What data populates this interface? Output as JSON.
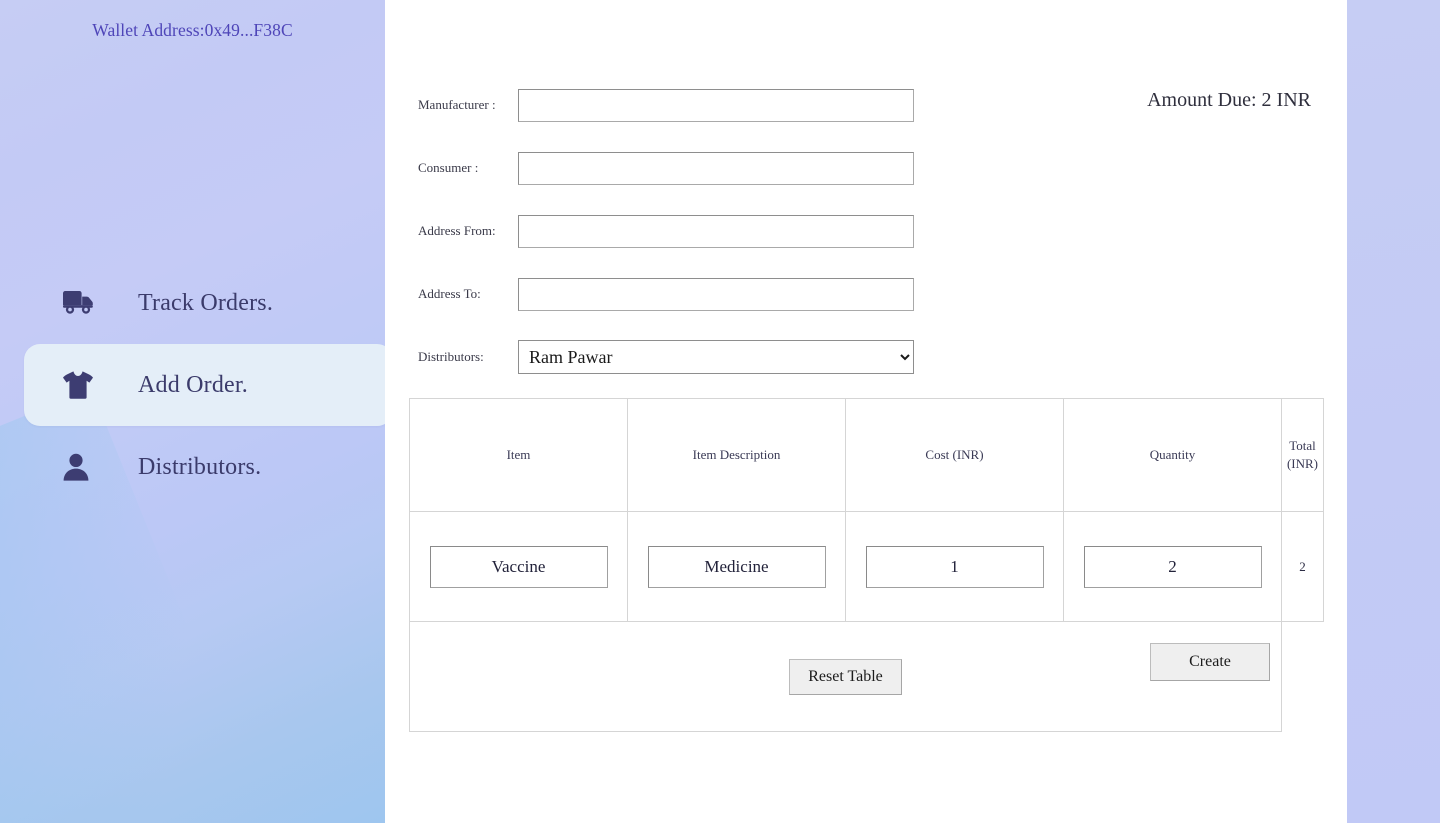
{
  "sidebar": {
    "wallet_label": "Wallet Address:0x49...F38C",
    "items": [
      {
        "label": "Track Orders.",
        "icon": "truck-icon",
        "active": false
      },
      {
        "label": "Add Order.",
        "icon": "tshirt-icon",
        "active": true
      },
      {
        "label": "Distributors.",
        "icon": "person-icon",
        "active": false
      }
    ],
    "gradient_from": "#c6cdf4",
    "gradient_to": "#9ec6ef",
    "active_bg": "#e4eef8",
    "wallet_color": "#4e45b8",
    "label_color": "#3b3b6b"
  },
  "form": {
    "fields": [
      {
        "label": "Manufacturer :",
        "value": "",
        "placeholder": ""
      },
      {
        "label": "Consumer :",
        "value": "",
        "placeholder": ""
      },
      {
        "label": "Address From:",
        "value": "",
        "placeholder": ""
      },
      {
        "label": "Address To:",
        "value": "",
        "placeholder": ""
      }
    ],
    "distributors": {
      "label": "Distributors:",
      "selected": "Ram Pawar",
      "options": [
        "Ram Pawar"
      ]
    },
    "amount_due": "Amount Due: 2 INR"
  },
  "table": {
    "headers": [
      "Item",
      "Item Description",
      "Cost (INR)",
      "Quantity",
      "Total (INR)"
    ],
    "rows": [
      {
        "item": "Vaccine",
        "description": "Medicine",
        "cost": "1",
        "quantity": "2",
        "total": "2"
      }
    ]
  },
  "buttons": {
    "reset_table": "Reset Table",
    "create": "Create"
  }
}
